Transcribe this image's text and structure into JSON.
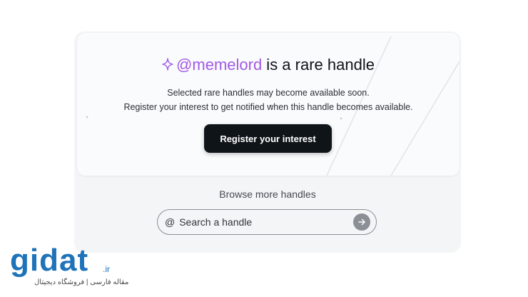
{
  "card": {
    "handle": "@memelord",
    "headline_suffix": " is a rare handle",
    "line1": "Selected rare handles may become available soon.",
    "line2": "Register your interest to get notified when this handle becomes available.",
    "cta_label": "Register your interest"
  },
  "browse": {
    "title": "Browse more handles",
    "at_symbol": "@",
    "placeholder": "Search a handle",
    "value": ""
  },
  "watermark": {
    "brand": "gidat",
    "tld": ".ir",
    "tagline": "مقاله فارسی | فروشگاه دیجیتال"
  },
  "icons": {
    "sparkle": "sparkle-icon",
    "arrow": "arrow-right-icon"
  },
  "colors": {
    "accent": "#a259e6",
    "button": "#0f1419",
    "brand_blue": "#1e73b9"
  }
}
